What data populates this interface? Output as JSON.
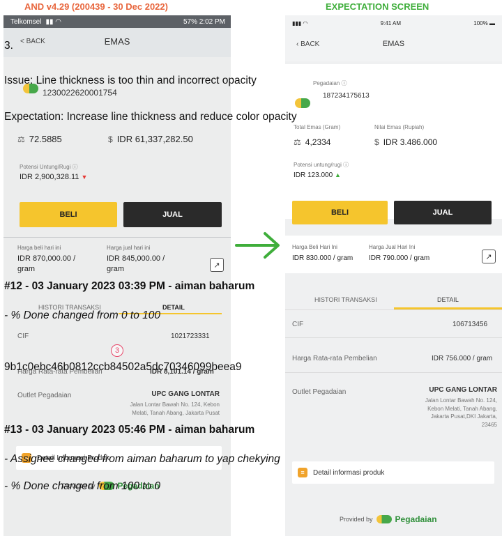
{
  "headers": {
    "left": "AND v4.29 (200439 - 30 Dec 2022)",
    "right": "EXPECTATION SCREEN"
  },
  "left_screen": {
    "status_carrier": "Telkomsel",
    "status_right": "57% 2:02 PM",
    "back": "< BACK",
    "title": "EMAS",
    "cif_number": "1230022620001754",
    "gold_weight": "72.5885",
    "gold_value": "IDR 61,337,282.50",
    "pl_label": "Potensi Untung/Rugi",
    "pl_value": "IDR 2,900,328.11",
    "buy": "BELI",
    "sell": "JUAL",
    "buy_price_label": "Harga beli hari ini",
    "sell_price_label": "Harga jual hari ini",
    "buy_price": "IDR 870,000.00 / gram",
    "sell_price": "IDR 845,000.00 / gram",
    "tab_history": "HISTORI TRANSAKSI",
    "tab_detail": "DETAIL",
    "cif_label": "CIF",
    "cif_value": "1021723331",
    "step": "3",
    "avg_label": "Harga Rata-rata Pembelian",
    "avg_value": "IDR 8,101.14 / gram",
    "outlet_label": "Outlet Pegadaian",
    "outlet_name": "UPC GANG LONTAR",
    "outlet_address": "Jalan Lontar Bawah No. 124, Kebon Melati, Tanah Abang, Jakarta Pusat",
    "info": "Detail Informasi Produk",
    "provided_by": "Provided by",
    "brand": "Pegadaian"
  },
  "right_screen": {
    "status_time": "9:41 AM",
    "status_battery": "100%",
    "back": "BACK",
    "title": "EMAS",
    "account_label": "Pegadaian",
    "account_number": "187234175613",
    "total_label": "Total Emas (Gram)",
    "value_label": "Nilai Emas (Rupiah)",
    "gold_weight": "4,2334",
    "gold_value": "IDR 3.486.000",
    "pl_label": "Potensi untung/rugi",
    "pl_value": "IDR 123.000",
    "buy": "BELI",
    "sell": "JUAL",
    "buy_price_label": "Harga Beli Hari Ini",
    "sell_price_label": "Harga Jual Hari Ini",
    "buy_price": "IDR 830.000 / gram",
    "sell_price": "IDR 790.000 / gram",
    "tab_history": "HISTORI TRANSAKSI",
    "tab_detail": "DETAIL",
    "cif_label": "CIF",
    "cif_value": "106713456",
    "avg_label": "Harga Rata-rata Pembelian",
    "avg_value": "IDR 756.000 / gram",
    "outlet_label": "Outlet Pegadaian",
    "outlet_name": "UPC GANG LONTAR",
    "outlet_address_1": "Jalan Lontar Bawah No. 124,",
    "outlet_address_2": "Kebon Melati, Tanah Abang,",
    "outlet_address_3": "Jakarta Pusat,DKI Jakarta,",
    "outlet_address_4": "23465",
    "info": "Detail informasi produk",
    "provided_by": "Provided by",
    "brand": "Pegadaian"
  },
  "journal": {
    "item": "3.",
    "issue": "Issue: Line thickness is too thin and incorrect opacity",
    "expectation": "Expectation: Increase line thickness and reduce color opacity",
    "entry12_title": "#12 - 03 January 2023 03:39 PM - aiman baharum",
    "entry12_change": "- % Done changed from 0 to 100",
    "hash": "9b1c0ebc46b0812ccb84502a5dc70346099beea9",
    "entry13_title": "#13 - 03 January 2023 05:46 PM - aiman baharum",
    "entry13_change1": "- Assignee changed from aiman baharum to yap chekying",
    "entry13_change2": "- % Done changed from 100 to 0"
  },
  "colors": {
    "accent_yellow": "#f5c52d",
    "green": "#3fae3b",
    "orange_header": "#e8663d",
    "dark_button": "#2a2a2a"
  },
  "icons": [
    "back-chevron-icon",
    "weight-scale-icon",
    "money-bag-icon",
    "info-circle-icon",
    "chart-icon",
    "document-icon",
    "arrow-right-icon"
  ]
}
